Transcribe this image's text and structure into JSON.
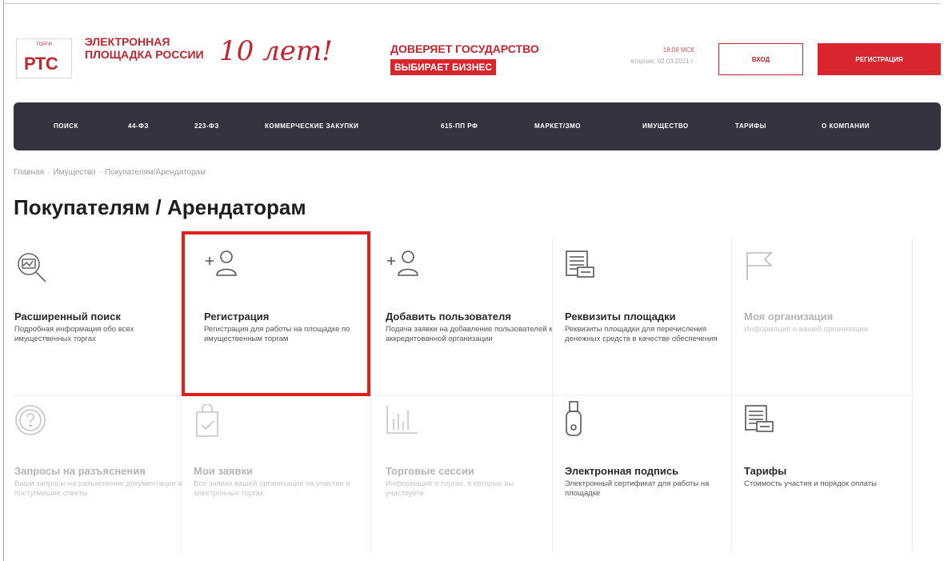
{
  "header": {
    "logo_small": "ТОРГИ",
    "logo_text": "РТС",
    "logo_title": "ЭЛЕКТРОННАЯ ПЛОЩАДКА РОССИИ",
    "anniversary": "10 лет!",
    "slogan_line1": "ДОВЕРЯЕТ ГОСУДАРСТВО",
    "slogan_line2": "ВЫБИРАЕТ БИЗНЕС",
    "time": "18:08 МСК",
    "date": "вторник, 02.03.2021 г.",
    "login_label": "ВХОД",
    "register_label": "РЕГИСТРАЦИЯ"
  },
  "nav": {
    "items": [
      {
        "label": "ПОИСК"
      },
      {
        "label": "44-ФЗ"
      },
      {
        "label": "223-ФЗ"
      },
      {
        "label": "КОММЕРЧЕСКИЕ ЗАКУПКИ"
      },
      {
        "label": "615-ПП РФ"
      },
      {
        "label": "МАРКЕТ/ЗМО"
      },
      {
        "label": "ИМУЩЕСТВО"
      },
      {
        "label": "ТАРИФЫ"
      },
      {
        "label": "О КОМПАНИИ"
      }
    ]
  },
  "breadcrumb": {
    "items": [
      "Главная",
      "Имущество",
      "Покупателям/Арендаторам"
    ],
    "separator": "·"
  },
  "page": {
    "title": "Покупателям / Арендаторам"
  },
  "cards": [
    {
      "title": "Расширенный поиск",
      "desc": "Подробная информация обо всех имущественных торгах",
      "icon": "search-document-icon",
      "enabled": true
    },
    {
      "title": "Регистрация",
      "desc": "Регистрация для работы на площадке по имущественным торгам",
      "icon": "add-user-icon",
      "enabled": true
    },
    {
      "title": "Добавить пользователя",
      "desc": "Подача заявки на добавление пользователей к аккредитованной организации",
      "icon": "add-user-icon",
      "enabled": true
    },
    {
      "title": "Реквизиты площадки",
      "desc": "Реквизиты площадки для перечисления денежных средств в качестве обеспечения",
      "icon": "requisites-icon",
      "enabled": true
    },
    {
      "title": "Моя организация",
      "desc": "Информация о вашей организации",
      "icon": "flag-icon",
      "enabled": false
    },
    {
      "title": "Запросы на разъяснения",
      "desc": "Ваши запросы на разъяснение документации и поступившие ответы",
      "icon": "question-icon",
      "enabled": false
    },
    {
      "title": "Мои заявки",
      "desc": "Все заявки вашей организации на участие в электронных торгах",
      "icon": "bag-check-icon",
      "enabled": false
    },
    {
      "title": "Торговые сессии",
      "desc": "Информация о торгах, в которых вы участвуете",
      "icon": "bar-chart-icon",
      "enabled": false
    },
    {
      "title": "Электронная подпись",
      "desc": "Электронный сертификат для работы на площадке",
      "icon": "usb-token-icon",
      "enabled": true
    },
    {
      "title": "Тарифы",
      "desc": "Стоимость участия и порядок оплаты",
      "icon": "requisites-icon",
      "enabled": true
    }
  ],
  "colors": {
    "brand_red": "#d9252e",
    "nav_bg": "#33343f",
    "highlight": "#e41d1d"
  }
}
